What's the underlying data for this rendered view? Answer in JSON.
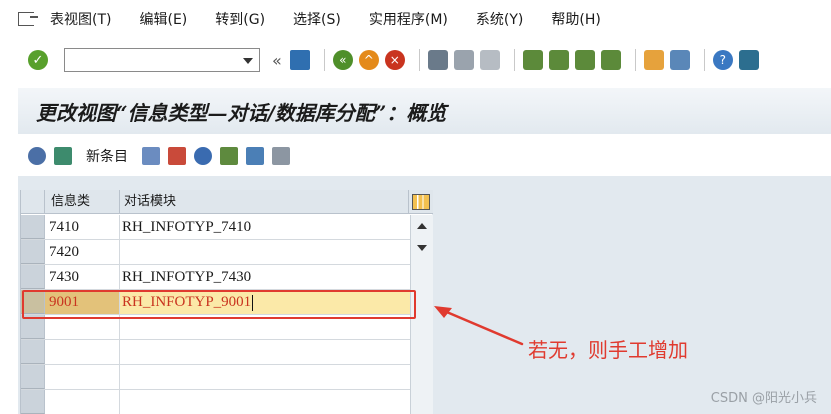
{
  "menu": {
    "items": [
      "表视图(T)",
      "编辑(E)",
      "转到(G)",
      "选择(S)",
      "实用程序(M)",
      "系统(Y)",
      "帮助(H)"
    ]
  },
  "toolbar": {
    "command_value": "",
    "prev_symbol": "«"
  },
  "title": "更改视图“信息类型—对话/数据库分配”：概览",
  "app_toolbar": {
    "new_entries_label": "新条目"
  },
  "table": {
    "headers": [
      "信息类",
      "对话模块"
    ],
    "rows": [
      {
        "c1": "7410",
        "c2": "RH_INFOTYP_7410"
      },
      {
        "c1": "7420",
        "c2": ""
      },
      {
        "c1": "7430",
        "c2": "RH_INFOTYP_7430"
      },
      {
        "c1": "9001",
        "c2": "RH_INFOTYP_9001"
      }
    ]
  },
  "annotation": {
    "text": "若无，则手工增加"
  },
  "watermark": "CSDN @阳光小兵",
  "colors": {
    "highlight_border": "#e03a2f",
    "title_bg": "#e2e9ef",
    "selected_row": "#fbe9a8"
  }
}
